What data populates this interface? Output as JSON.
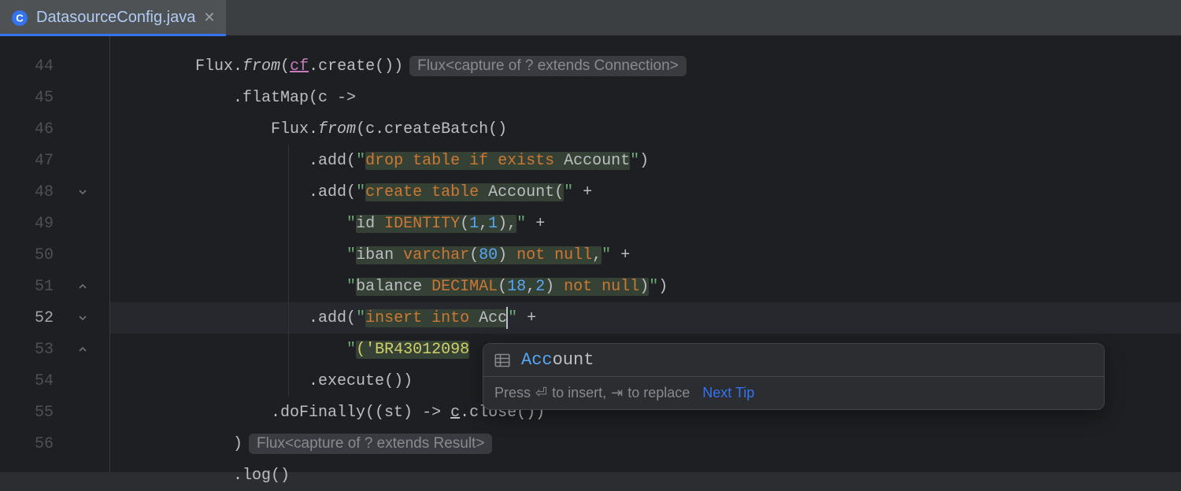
{
  "tab": {
    "label": "DatasourceConfig.java"
  },
  "gutter": {
    "lines": [
      44,
      45,
      46,
      47,
      48,
      49,
      50,
      51,
      52,
      53,
      54,
      55,
      56
    ],
    "current": 52,
    "folds": [
      48,
      51,
      52,
      53
    ]
  },
  "inlays": {
    "line44": "Flux<capture of ? extends Connection>",
    "line56": "Flux<capture of ? extends Result>"
  },
  "code": {
    "l44": {
      "prefix": "Flux.",
      "from": "from",
      "lp": "(",
      "cf": "cf",
      "tail": ".create())"
    },
    "l45": {
      "text": ".flatMap(c ->"
    },
    "l46": {
      "prefix": "Flux.",
      "from": "from",
      "tail": "(c.createBatch()"
    },
    "l47": {
      "add": ".add(",
      "q1": "\"",
      "kw1": "drop table if exists ",
      "tbl": "Account",
      "q2": "\"",
      "rp": ")"
    },
    "l48": {
      "add": ".add(",
      "q1": "\"",
      "kw1": "create table ",
      "tbl": "Account",
      "lp": "(",
      "q2": "\"",
      "concat": " +"
    },
    "l49": {
      "q1": "\"",
      "col": "id ",
      "kw": "IDENTITY",
      "args": "(",
      "n1": "1",
      "n2": ",",
      "n3": "1",
      "rp": "),",
      "q2": "\"",
      "concat": " +"
    },
    "l50": {
      "q1": "\"",
      "col": "iban ",
      "kw": "varchar",
      "args": "(",
      "n1": "80",
      "rp": ") ",
      "kw2": "not null",
      "c": ",",
      "q2": "\"",
      "concat": " +"
    },
    "l51": {
      "q1": "\"",
      "col": "balance ",
      "kw": "DECIMAL",
      "args": "(",
      "n1": "18",
      "c": ",",
      "n2": "2",
      "rp": ") ",
      "kw2": "not null",
      "rp2": ")",
      "q2": "\"",
      "end": ")"
    },
    "l52": {
      "add": ".add(",
      "q1": "\"",
      "kw1": "insert into ",
      "partial": "Acc",
      "q2": "\"",
      "concat": " +"
    },
    "l53": {
      "q1": "\"",
      "lp": "(",
      "str": "'BR43012098"
    },
    "l54": {
      "text": ".execute())"
    },
    "l55": {
      "pre": ".doFinally((st) -> ",
      "c": "c",
      "tail": ".close())"
    },
    "l56": {
      "text": ")"
    },
    "lend": {
      "text": ".log()"
    }
  },
  "popup": {
    "match": "Acc",
    "rest": "ount",
    "hint_pre": "Press ",
    "hint_insert": " to insert, ",
    "hint_replace": " to replace",
    "next_tip": "Next Tip"
  }
}
